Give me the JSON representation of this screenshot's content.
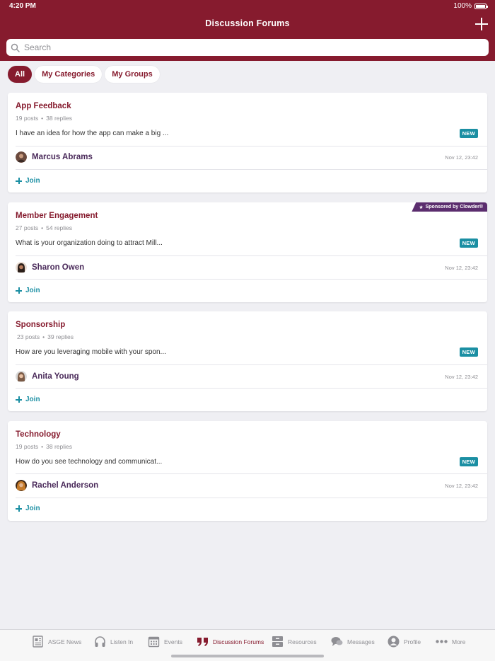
{
  "status_bar": {
    "time": "4:20 PM",
    "battery": "100%"
  },
  "header": {
    "title": "Discussion Forums"
  },
  "search": {
    "placeholder": "Search"
  },
  "filters": [
    "All",
    "My Categories",
    "My Groups"
  ],
  "forums": [
    {
      "title": "App Feedback",
      "posts": "19 posts",
      "replies": "38 replies",
      "excerpt": "I have an idea for how the app can make a big ...",
      "badge": "NEW",
      "author": "Marcus Abrams",
      "time": "Nov 12, 23:42",
      "join": "Join",
      "sponsor": null
    },
    {
      "title": "Member Engagement",
      "posts": "27 posts",
      "replies": "54 replies",
      "excerpt": "What is your organization doing to attract Mill...",
      "badge": "NEW",
      "author": "Sharon Owen",
      "time": "Nov 12, 23:42",
      "join": "Join",
      "sponsor": "Sponsored by Clowder®"
    },
    {
      "title": "Sponsorship",
      "posts": "23 posts",
      "replies": "39 replies",
      "excerpt": "How are you leveraging mobile with your spon...",
      "badge": "NEW",
      "author": "Anita Young",
      "time": "Nov 12, 23:42",
      "join": "Join",
      "sponsor": null
    },
    {
      "title": "Technology",
      "posts": "19 posts",
      "replies": "38 replies",
      "excerpt": "How do you see technology and communicat...",
      "badge": "NEW",
      "author": "Rachel Anderson",
      "time": "Nov 12, 23:42",
      "join": "Join",
      "sponsor": null
    }
  ],
  "tabs": [
    {
      "label": "ASGE News",
      "icon": "news-icon"
    },
    {
      "label": "Listen In",
      "icon": "headphones-icon"
    },
    {
      "label": "Events",
      "icon": "calendar-icon"
    },
    {
      "label": "Discussion Forums",
      "icon": "quote-icon",
      "active": true
    },
    {
      "label": "Resources",
      "icon": "archive-icon"
    },
    {
      "label": "Messages",
      "icon": "chat-icon"
    },
    {
      "label": "Profile",
      "icon": "person-icon"
    },
    {
      "label": "More",
      "icon": "more-icon"
    }
  ],
  "colors": {
    "brand": "#861b2e",
    "accent": "#1b8fa3",
    "sponsor": "#5b2d6e"
  }
}
